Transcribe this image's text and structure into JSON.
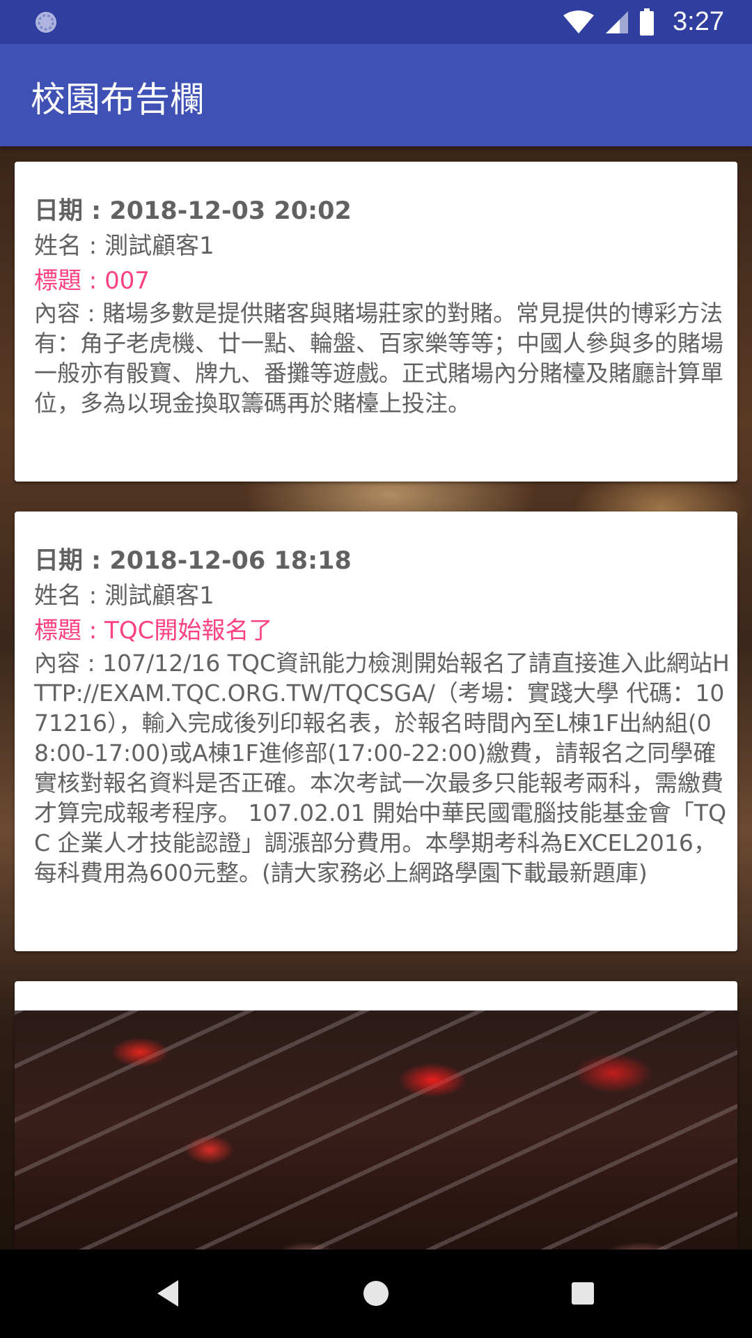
{
  "status_bar": {
    "time": "3:27",
    "icons": [
      "sync-icon",
      "wifi-icon",
      "cell-signal-icon",
      "battery-icon"
    ]
  },
  "app_bar": {
    "title": "校園布告欄"
  },
  "posts": [
    {
      "date": "日期 : 2018-12-03 20:02",
      "name": "姓名 : 測試顧客1",
      "title": "標題 : 007",
      "content": "內容 : 賭場多數是提供賭客與賭場莊家的對賭。常見提供的博彩方法有：角子老虎機、廿一點、輪盤、百家樂等等；中國人參與多的賭場一般亦有骰寶、牌九、番攤等遊戲。正式賭場內分賭檯及賭廳計算單位，多為以現金換取籌碼再於賭檯上投注。"
    },
    {
      "date": "日期 : 2018-12-06 18:18",
      "name": "姓名 : 測試顧客1",
      "title": "標題 : TQC開始報名了",
      "content": "內容 : 107/12/16 TQC資訊能力檢測開始報名了請直接進入此網站HTTP://EXAM.TQC.ORG.TW/TQCSGA/（考場：實踐大學 代碼：1071216），輸入完成後列印報名表，於報名時間內至L棟1F出納組(08:00-17:00)或A棟1F進修部(17:00-22:00)繳費，請報名之同學確實核對報名資料是否正確。本次考試一次最多只能報考兩科，需繳費才算完成報考程序。 107.02.01 開始中華民國電腦技能基金會「TQC 企業人才技能認證」調漲部分費用。本學期考科為EXCEL2016，每科費用為600元整。(請大家務必上網路學園下載最新題庫)"
    }
  ],
  "colors": {
    "status_bar": "#303f9f",
    "app_bar": "#3f51b5",
    "title_accent": "#ff4081",
    "body_text": "#616161"
  },
  "nav_bar": {
    "icons": [
      "back-icon",
      "home-icon",
      "recents-icon"
    ]
  }
}
